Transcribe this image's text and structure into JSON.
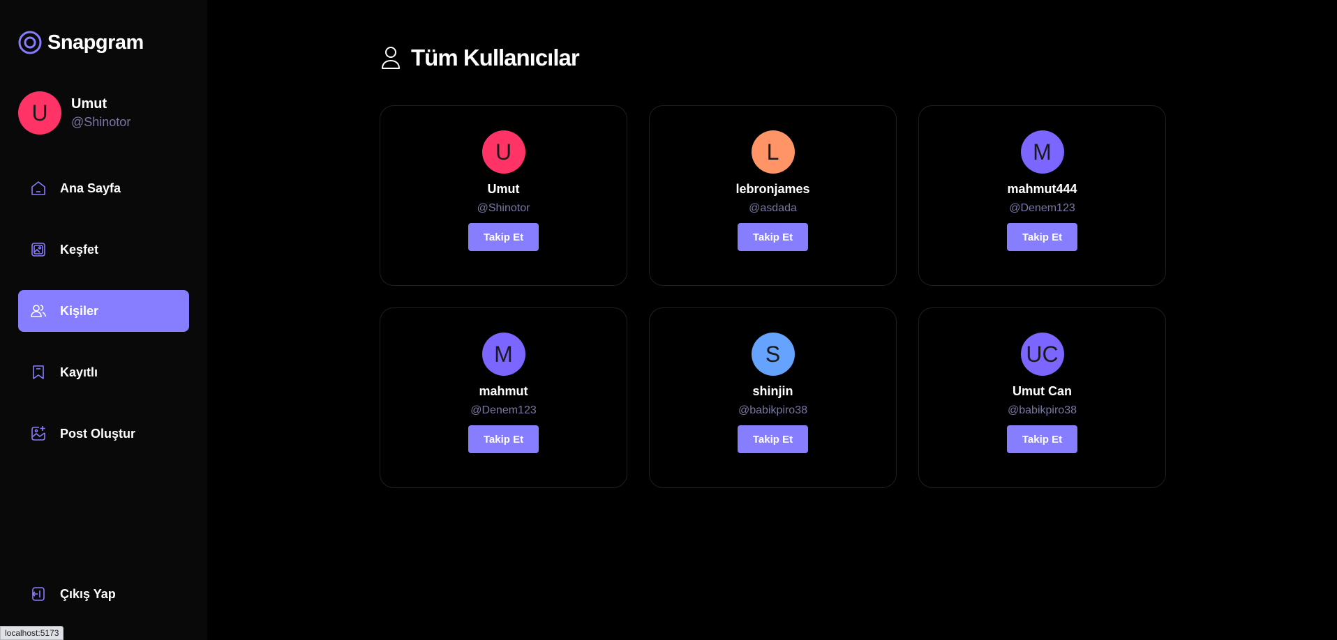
{
  "app": {
    "name": "Snapgram"
  },
  "colors": {
    "accent": "#877eff",
    "muted": "#7878a3"
  },
  "current_user": {
    "initial": "U",
    "name": "Umut",
    "handle": "@Shinotor",
    "avatar_color": "#ff3366"
  },
  "nav": [
    {
      "label": "Ana Sayfa",
      "icon": "home-icon",
      "active": false
    },
    {
      "label": "Keşfet",
      "icon": "gallery-icon",
      "active": false
    },
    {
      "label": "Kişiler",
      "icon": "people-icon",
      "active": true
    },
    {
      "label": "Kayıtlı",
      "icon": "bookmark-icon",
      "active": false
    },
    {
      "label": "Post Oluştur",
      "icon": "create-post-icon",
      "active": false
    }
  ],
  "logout": {
    "label": "Çıkış Yap",
    "icon": "logout-icon"
  },
  "page": {
    "title": "Tüm Kullanıcılar",
    "icon": "user-icon"
  },
  "follow_label": "Takip Et",
  "users": [
    {
      "initial": "U",
      "name": "Umut",
      "handle": "@Shinotor",
      "color": "#ff3366"
    },
    {
      "initial": "L",
      "name": "lebronjames",
      "handle": "@asdada",
      "color": "#ff9466"
    },
    {
      "initial": "M",
      "name": "mahmut444",
      "handle": "@Denem123",
      "color": "#7b66ff"
    },
    {
      "initial": "M",
      "name": "mahmut",
      "handle": "@Denem123",
      "color": "#7b66ff"
    },
    {
      "initial": "S",
      "name": "shinjin",
      "handle": "@babikpiro38",
      "color": "#66a3ff"
    },
    {
      "initial": "UC",
      "name": "Umut Can",
      "handle": "@babikpiro38",
      "color": "#7b66ff"
    }
  ],
  "status_bar": {
    "url": "localhost:5173"
  }
}
